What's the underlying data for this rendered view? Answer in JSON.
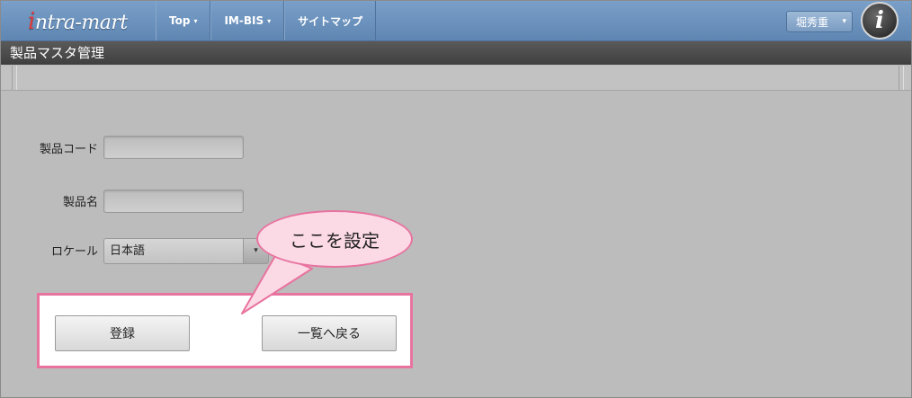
{
  "header": {
    "logo_prefix": "i",
    "logo_text": "ntra-mart",
    "nav": [
      {
        "label": "Top",
        "caret": "▾"
      },
      {
        "label": "IM-BIS",
        "caret": "▾"
      },
      {
        "label": "サイトマップ",
        "caret": ""
      }
    ],
    "user_name": "堀秀重",
    "user_caret": "▾",
    "avatar_letter": "i"
  },
  "page": {
    "title": "製品マスタ管理"
  },
  "form": {
    "product_code_label": "製品コード",
    "product_code_value": "",
    "product_name_label": "製品名",
    "product_name_value": "",
    "locale_label": "ロケール",
    "locale_value": "日本語",
    "locale_arrow": "▾"
  },
  "actions": {
    "register_label": "登録",
    "back_label": "一覧へ戻る"
  },
  "callout": {
    "text": "ここを設定"
  },
  "colors": {
    "header_blue": "#6a91bc",
    "title_dark": "#4a4a4a",
    "highlight_pink": "#e8739f",
    "bubble_fill": "#fbd9e5"
  }
}
